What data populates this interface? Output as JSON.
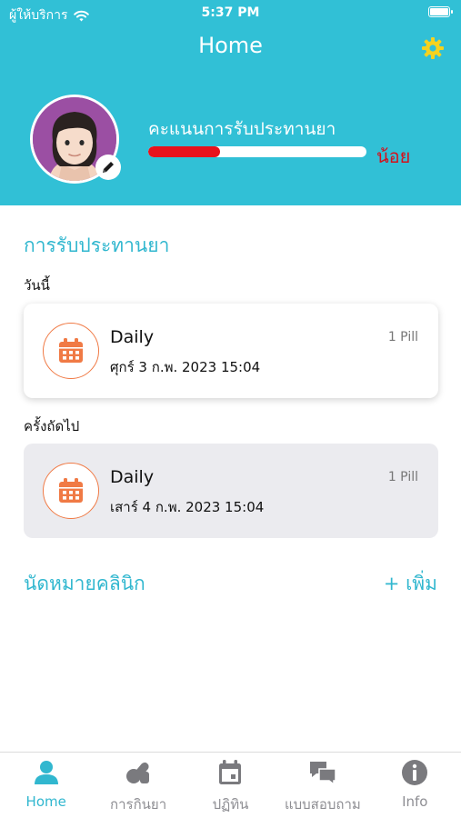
{
  "status_bar": {
    "carrier": "ผู้ให้บริการ",
    "time": "5:37 PM"
  },
  "header": {
    "title": "Home"
  },
  "profile": {
    "score_label": "คะแนนการรับประทานยา",
    "score_level": "น้อย",
    "score_fraction": 0.33
  },
  "medication": {
    "section_title": "การรับประทานยา",
    "today_label": "วันนี้",
    "next_label": "ครั้งถัดไป",
    "today": {
      "title": "Daily",
      "date": "ศุกร์ 3 ก.พ. 2023 15:04",
      "pill": "1 Pill"
    },
    "next": {
      "title": "Daily",
      "date": "เสาร์ 4 ก.พ. 2023 15:04",
      "pill": "1 Pill"
    }
  },
  "clinic": {
    "title": "นัดหมายคลินิก",
    "add_label": "+ เพิ่ม"
  },
  "tabs": [
    {
      "label": "Home",
      "icon": "person-icon",
      "active": true
    },
    {
      "label": "การกินยา",
      "icon": "pills-icon",
      "active": false
    },
    {
      "label": "ปฏิทิน",
      "icon": "calendar-icon",
      "active": false
    },
    {
      "label": "แบบสอบถาม",
      "icon": "chat-bubbles-icon",
      "active": false
    },
    {
      "label": "Info",
      "icon": "info-icon",
      "active": false
    }
  ],
  "colors": {
    "header_bg": "#31c0d6",
    "accent": "#31b7cf",
    "score_fill": "#e8121c",
    "score_level": "#d4101b",
    "calendar_icon": "#f07a45",
    "gear": "#f5d21f"
  }
}
